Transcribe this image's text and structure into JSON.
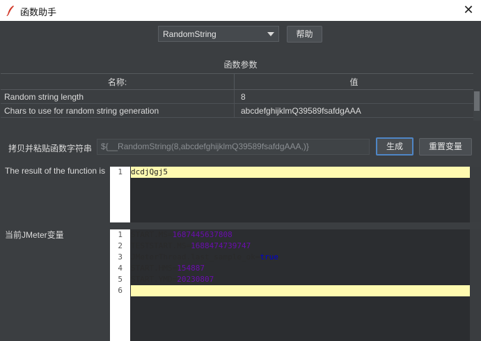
{
  "window": {
    "title": "函数助手"
  },
  "function_select": {
    "value": "RandomString"
  },
  "help_button": "帮助",
  "params_section_title": "函数参数",
  "table": {
    "headers": [
      "名称:",
      "值"
    ],
    "rows": [
      [
        "Random string length",
        "8"
      ],
      [
        "Chars to use for random string generation",
        "abcdefghijklmQ39589fsafdgAAA"
      ]
    ]
  },
  "copy_label": "拷贝并粘贴函数字符串",
  "function_string": "${__RandomString(8,abcdefghijklmQ39589fsafdgAAA,)}",
  "generate_button": "生成",
  "reset_button": "重置变量",
  "result_label": "The result of the function is",
  "result_lines": [
    {
      "n": "1",
      "text": "dcdjQgj5"
    }
  ],
  "vars_label": "当前JMeter变量",
  "var_lines": [
    {
      "n": "1",
      "key": "START.MS",
      "eq": "=",
      "val": "1687445637808"
    },
    {
      "n": "2",
      "key": "TESTSTART.MS",
      "eq": "=",
      "val": "1688474739747"
    },
    {
      "n": "3",
      "key": "JMeterThread.last_sample_ok",
      "eq": "=",
      "val": "true"
    },
    {
      "n": "4",
      "key": "START.HMS",
      "eq": "=",
      "val": "154887"
    },
    {
      "n": "5",
      "key": "START.YMD",
      "eq": "=",
      "val": "20230807"
    },
    {
      "n": "6",
      "key": "",
      "eq": "",
      "val": ""
    }
  ]
}
